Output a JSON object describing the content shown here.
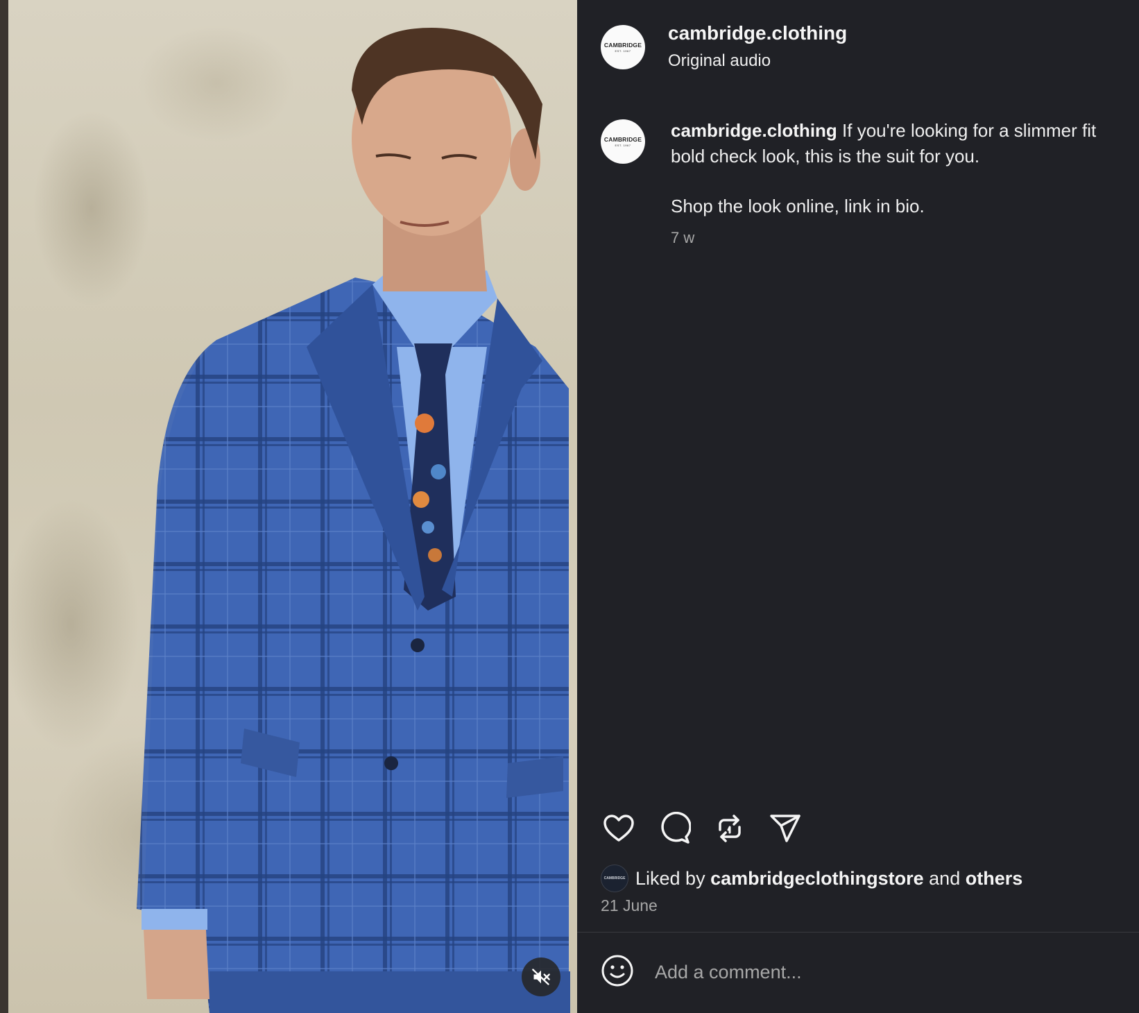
{
  "post": {
    "username": "cambridge.clothing",
    "audio": "Original audio",
    "avatar_text": "CAMBRIDGE",
    "avatar_subtext": "EST. 1967"
  },
  "caption": {
    "username": "cambridge.clothing",
    "line1": "If you're looking for a slimmer fit",
    "line2": "bold check look, this is the suit for you.",
    "line3": "Shop the look online, link in bio.",
    "time": "7 w"
  },
  "actions": {
    "icons": [
      "heart-icon",
      "comment-icon",
      "repost-icon",
      "share-icon"
    ]
  },
  "likes": {
    "prefix": "Liked by",
    "user": "cambridgeclothingstore",
    "and": "and",
    "others": "others",
    "mini_avatar_text": "CAMBRIDGE"
  },
  "date": "21 June",
  "comment": {
    "placeholder": "Add a comment..."
  },
  "colors": {
    "panel_bg": "#202126",
    "text": "#f5f5f5",
    "muted": "#a8a8a8",
    "divider": "#3a3b40",
    "suit_blue": "#3f66b5"
  }
}
